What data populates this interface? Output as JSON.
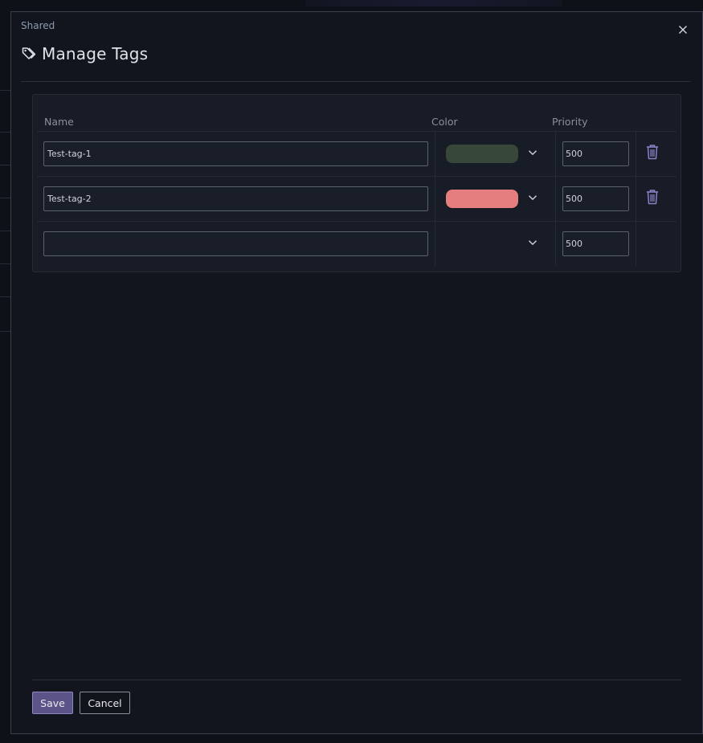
{
  "breadcrumb": "Shared",
  "dialog": {
    "title": "Manage Tags",
    "close_label": "×"
  },
  "table": {
    "headers": {
      "name": "Name",
      "color": "Color",
      "priority": "Priority"
    },
    "rows": [
      {
        "name": "Test-tag-1",
        "color": "#37483a",
        "priority": "500",
        "deletable": true
      },
      {
        "name": "Test-tag-2",
        "color": "#e57e7e",
        "priority": "500",
        "deletable": true
      },
      {
        "name": "",
        "color": null,
        "priority": "500",
        "deletable": false
      }
    ]
  },
  "footer": {
    "save_label": "Save",
    "cancel_label": "Cancel"
  },
  "colors": {
    "accent": "#5c5488",
    "trash_icon": "#8a82c8"
  }
}
